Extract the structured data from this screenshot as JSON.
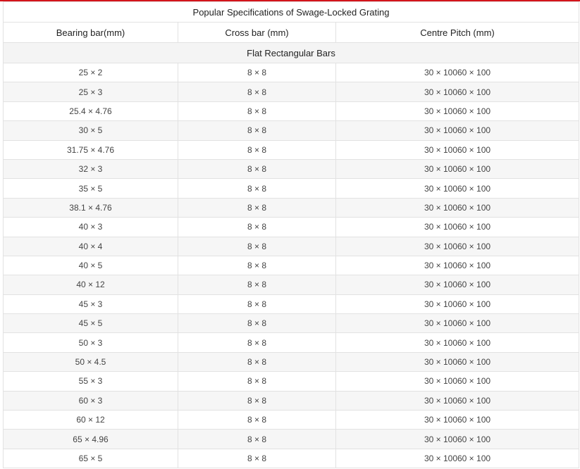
{
  "table": {
    "title": "Popular Specifications of Swage-Locked Grating",
    "headers": [
      "Bearing bar(mm)",
      "Cross bar (mm)",
      "Centre Pitch (mm)"
    ],
    "section": "Flat Rectangular Bars",
    "rows": [
      [
        "25 × 2",
        "8 × 8",
        "30 × 10060 × 100"
      ],
      [
        "25 × 3",
        "8 × 8",
        "30 × 10060 × 100"
      ],
      [
        "25.4 × 4.76",
        "8 × 8",
        "30 × 10060 × 100"
      ],
      [
        "30 × 5",
        "8 × 8",
        "30 × 10060 × 100"
      ],
      [
        "31.75 × 4.76",
        "8 × 8",
        "30 × 10060 × 100"
      ],
      [
        "32 × 3",
        "8 × 8",
        "30 × 10060 × 100"
      ],
      [
        "35 × 5",
        "8 × 8",
        "30 × 10060 × 100"
      ],
      [
        "38.1 × 4.76",
        "8 × 8",
        "30 × 10060 × 100"
      ],
      [
        "40 × 3",
        "8 × 8",
        "30 × 10060 × 100"
      ],
      [
        "40 × 4",
        "8 × 8",
        "30 × 10060 × 100"
      ],
      [
        "40 × 5",
        "8 × 8",
        "30 × 10060 × 100"
      ],
      [
        "40 × 12",
        "8 × 8",
        "30 × 10060 × 100"
      ],
      [
        "45 × 3",
        "8 × 8",
        "30 × 10060 × 100"
      ],
      [
        "45 × 5",
        "8 × 8",
        "30 × 10060 × 100"
      ],
      [
        "50 × 3",
        "8 × 8",
        "30 × 10060 × 100"
      ],
      [
        "50 × 4.5",
        "8 × 8",
        "30 × 10060 × 100"
      ],
      [
        "55 × 3",
        "8 × 8",
        "30 × 10060 × 100"
      ],
      [
        "60 × 3",
        "8 × 8",
        "30 × 10060 × 100"
      ],
      [
        "60 × 12",
        "8 × 8",
        "30 × 10060 × 100"
      ],
      [
        "65 × 4.96",
        "8 × 8",
        "30 × 10060 × 100"
      ],
      [
        "65 × 5",
        "8 × 8",
        "30 × 10060 × 100"
      ]
    ]
  },
  "colors": {
    "accent": "#d3141b",
    "border": "#e2e2e2",
    "section_bg": "#f4f4f4",
    "stripe_bg": "#f6f6f6"
  }
}
